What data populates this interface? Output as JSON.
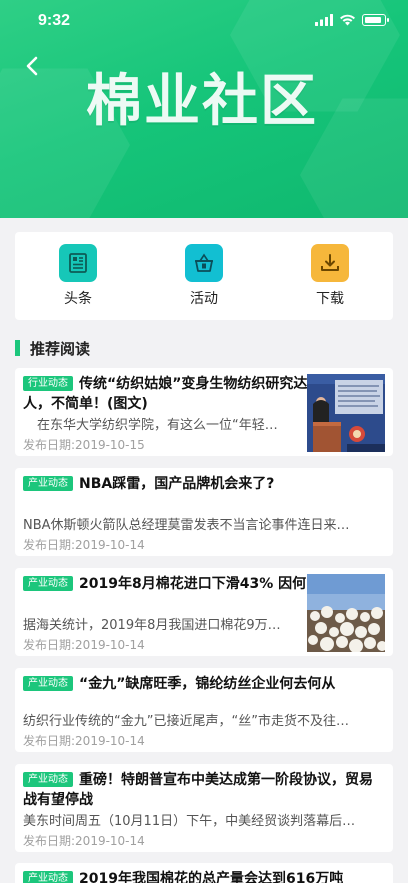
{
  "status_bar": {
    "time": "9:32"
  },
  "header": {
    "title": "棉业社区"
  },
  "categories": [
    {
      "label": "头条",
      "icon": "newspaper-icon",
      "color": "#16c7b8"
    },
    {
      "label": "活动",
      "icon": "gift-basket-icon",
      "color": "#12bfd2"
    },
    {
      "label": "下载",
      "icon": "download-icon",
      "color": "#f6b73b"
    }
  ],
  "section": {
    "title": "推荐阅读"
  },
  "articles": [
    {
      "tag": "行业动态",
      "title": "传统“纺织姑娘”变身生物纺织研究达人，不简单！(图文)",
      "summary": "在东华大学纺织学院，有这么一位“年轻…",
      "date": "发布日期:2019-10-15",
      "image": "lecture-photo"
    },
    {
      "tag": "产业动态",
      "title": "NBA踩雷，国产品牌机会来了?",
      "summary": "NBA休斯顿火箭队总经理莫雷发表不当言论事件连日来…",
      "date": "发布日期:2019-10-14"
    },
    {
      "tag": "产业动态",
      "title": "2019年8月棉花进口下滑43% 因何",
      "summary": "据海关统计，2019年8月我国进口棉花9万…",
      "date": "发布日期:2019-10-14",
      "image": "cotton-photo"
    },
    {
      "tag": "产业动态",
      "title": "“金九”缺席旺季，锦纶纺丝企业何去何从",
      "summary": "纺织行业传统的“金九”已接近尾声，“丝”市走货不及往…",
      "date": "发布日期:2019-10-14"
    },
    {
      "tag": "产业动态",
      "title": "重磅！特朗普宣布中美达成第一阶段协议，贸易战有望停战",
      "summary": "美东时间周五（10月11日）下午，中美经贸谈判落幕后…",
      "date": "发布日期:2019-10-14"
    },
    {
      "tag": "产业动态",
      "title": "2019年我国棉花的总产量会达到616万吨",
      "summary": "",
      "date": ""
    }
  ]
}
